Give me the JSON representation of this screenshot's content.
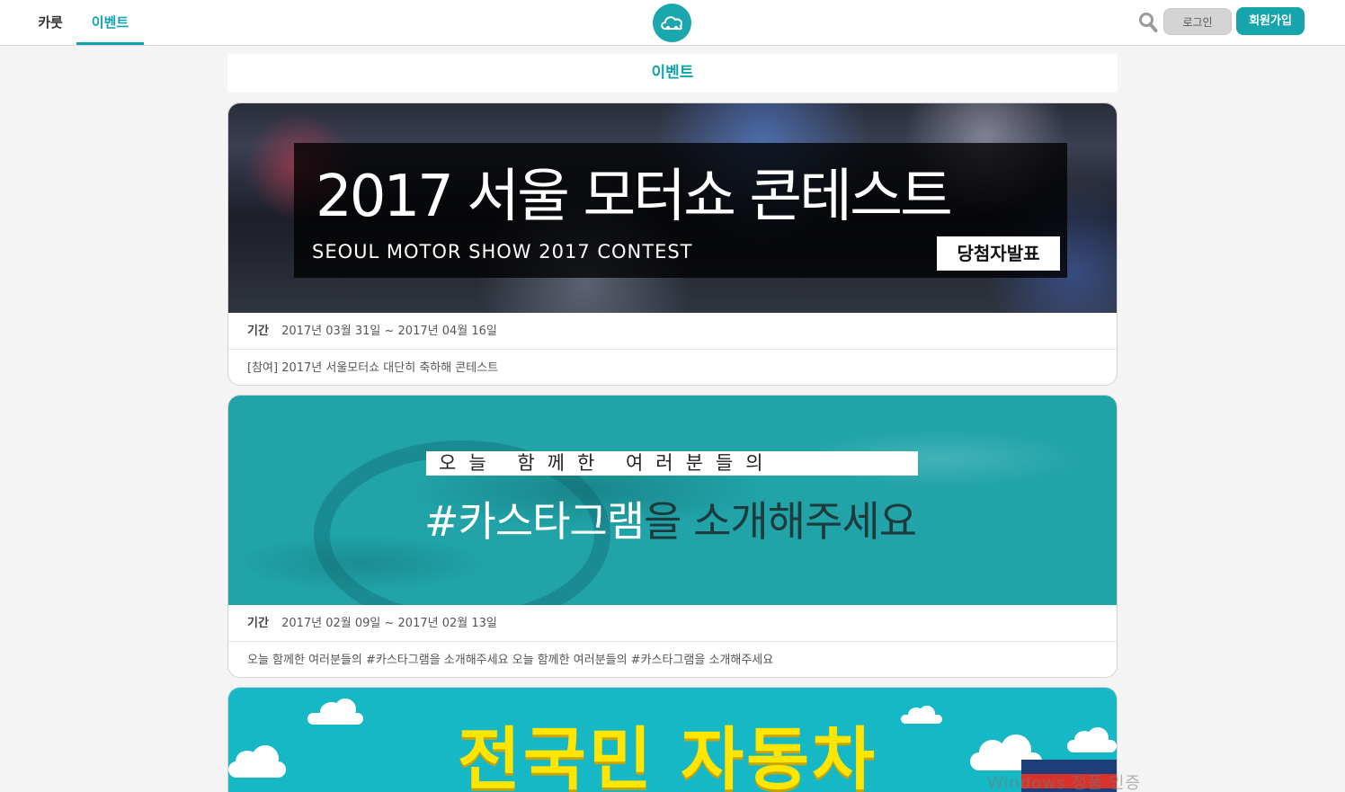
{
  "header": {
    "tabs": [
      {
        "label": "카룻"
      },
      {
        "label": "이벤트"
      }
    ],
    "login_label": "로그인",
    "join_label": "회원가입",
    "accent_color": "#11a3ad"
  },
  "page": {
    "title": "이벤트"
  },
  "events": [
    {
      "banner_title": "2017 서울 모터쇼 콘테스트",
      "banner_subtitle": "SEOUL MOTOR SHOW 2017 CONTEST",
      "banner_tag": "당첨자발표",
      "period_label": "기간",
      "period": "2017년 03월 31일 ~ 2017년 04월 16일",
      "description": "[참여] 2017년 서울모터쇼 대단히 축하해 콘테스트"
    },
    {
      "banner_line1": "오늘 함께한 여러분들의",
      "banner_title_a": "#카스타그램",
      "banner_title_b": "을 소개해주세요",
      "period_label": "기간",
      "period": "2017년 02월 09일 ~ 2017년 02월 13일",
      "description": "오늘 함께한 여러분들의 #카스타그램을 소개해주세요 오늘 함께한 여러분들의 #카스타그램을 소개해주세요"
    },
    {
      "banner_title": "전국민 자동차"
    }
  ],
  "watermark": "Windows 정품 인증"
}
